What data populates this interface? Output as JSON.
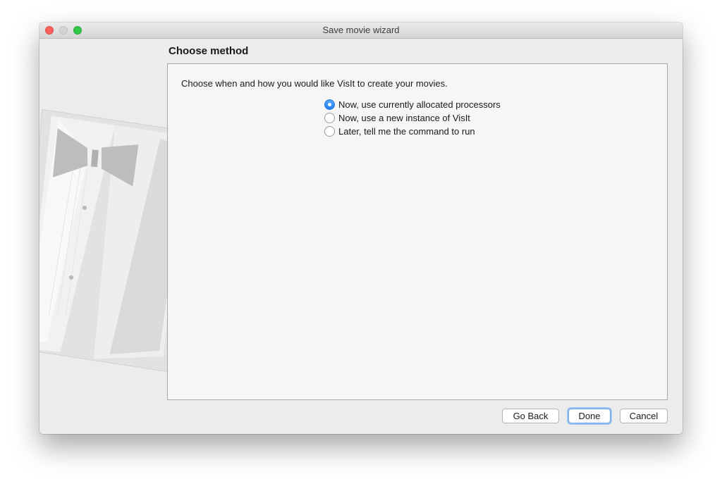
{
  "window": {
    "title": "Save movie wizard"
  },
  "page": {
    "heading": "Choose method",
    "instruction": "Choose when and how you would like VisIt to create your movies."
  },
  "options": [
    {
      "label": "Now, use currently allocated processors",
      "selected": true
    },
    {
      "label": "Now, use a new instance of VisIt",
      "selected": false
    },
    {
      "label": "Later, tell me the command to run",
      "selected": false
    }
  ],
  "buttons": {
    "back": "Go Back",
    "done": "Done",
    "cancel": "Cancel"
  },
  "colors": {
    "accent": "#1e7ef2",
    "close": "#fc605c",
    "zoom": "#34c84a"
  }
}
